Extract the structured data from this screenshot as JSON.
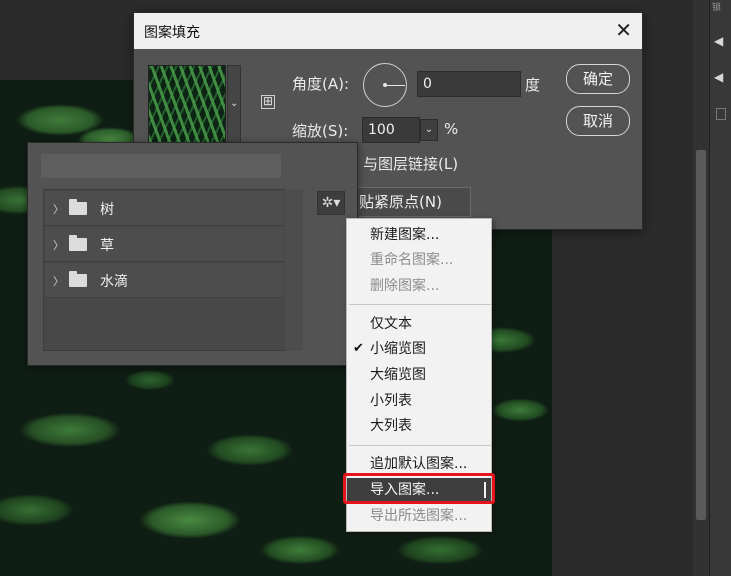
{
  "dialog": {
    "title": "图案填充",
    "angle_label": "角度(A):",
    "angle_value": "0",
    "angle_unit": "度",
    "scale_label": "缩放(S):",
    "scale_value": "100",
    "scale_unit": "%",
    "link_label": "与图层链接(L)",
    "snap_label": "贴紧原点(N)",
    "ok_label": "确定",
    "cancel_label": "取消",
    "close_glyph": "✕",
    "new_pattern_glyph": "⊞",
    "dropdown_glyph": "⌄"
  },
  "picker": {
    "folders": [
      {
        "name": "树",
        "chevron": "〉"
      },
      {
        "name": "草",
        "chevron": "〉"
      },
      {
        "name": "水滴",
        "chevron": "〉"
      }
    ],
    "gear_glyph": "✲▾"
  },
  "menu": {
    "items": [
      {
        "label": "新建图案...",
        "enabled": true
      },
      {
        "label": "重命名图案...",
        "enabled": false
      },
      {
        "label": "删除图案...",
        "enabled": false
      },
      {
        "label": "仅文本",
        "enabled": true
      },
      {
        "label": "小缩览图",
        "enabled": true,
        "checked": true
      },
      {
        "label": "大缩览图",
        "enabled": true
      },
      {
        "label": "小列表",
        "enabled": true
      },
      {
        "label": "大列表",
        "enabled": true
      },
      {
        "label": "追加默认图案...",
        "enabled": true
      },
      {
        "label": "导入图案...",
        "enabled": true,
        "highlighted": true
      },
      {
        "label": "导出所选图案...",
        "enabled": false
      }
    ],
    "check_glyph": "✔"
  },
  "right_panel": {
    "tiny_label": "锁",
    "eye_glyph": "◀"
  },
  "colors": {
    "highlight_box": "#e8141b",
    "dialog_bg": "#535353",
    "menu_bg": "#f2f2f2"
  }
}
